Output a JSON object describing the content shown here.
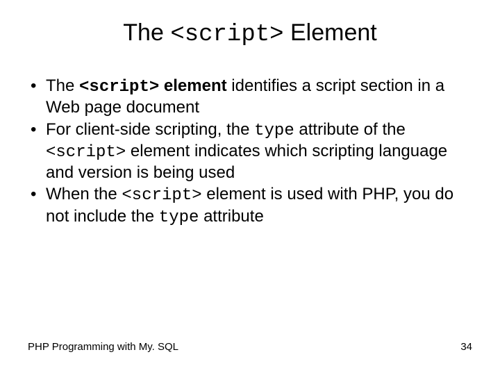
{
  "title": {
    "pre": "The ",
    "code": "<script>",
    "post": " Element"
  },
  "bullets": [
    {
      "segments": [
        {
          "text": "The ",
          "cls": ""
        },
        {
          "text": "<script>",
          "cls": "mono bold"
        },
        {
          "text": " element",
          "cls": "bold"
        },
        {
          "text": " identifies a script section in a Web page document",
          "cls": ""
        }
      ]
    },
    {
      "segments": [
        {
          "text": "For client-side scripting, the ",
          "cls": ""
        },
        {
          "text": "type",
          "cls": "mono"
        },
        {
          "text": " attribute of the ",
          "cls": ""
        },
        {
          "text": "<script>",
          "cls": "mono"
        },
        {
          "text": " element indicates which scripting language and version is being used",
          "cls": ""
        }
      ]
    },
    {
      "segments": [
        {
          "text": "When the ",
          "cls": ""
        },
        {
          "text": "<script>",
          "cls": "mono"
        },
        {
          "text": " element is used with PHP, you do not include the ",
          "cls": ""
        },
        {
          "text": "type",
          "cls": "mono"
        },
        {
          "text": " attribute",
          "cls": ""
        }
      ]
    }
  ],
  "footer": {
    "left": "PHP Programming with My. SQL",
    "right": "34"
  }
}
